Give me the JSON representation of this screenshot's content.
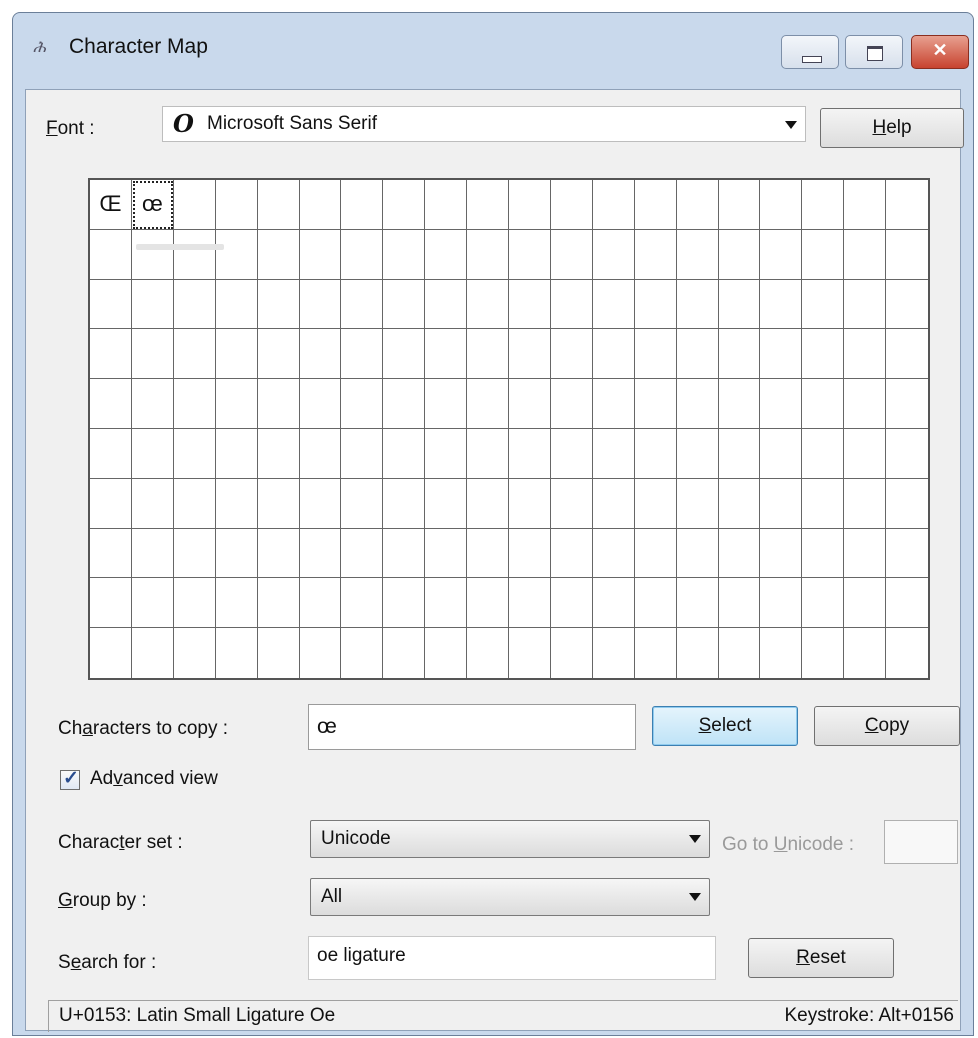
{
  "window": {
    "title": "Character Map",
    "controls": {
      "minimize": "–",
      "maximize": "□",
      "close": "✕"
    }
  },
  "font": {
    "label_prefix": "",
    "label_accel": "F",
    "label_rest": "ont :",
    "value": "Microsoft Sans Serif",
    "font_icon": "O"
  },
  "help_button": {
    "accel": "H",
    "rest": "elp"
  },
  "grid": {
    "columns": 20,
    "rows": 10,
    "characters": [
      "Œ",
      "œ"
    ],
    "selected_index": 1
  },
  "copy": {
    "label_pre": "Ch",
    "label_accel": "a",
    "label_post": "racters to copy :",
    "value": "œ",
    "select_accel": "S",
    "select_rest": "elect",
    "copy_accel": "C",
    "copy_rest": "opy"
  },
  "advanced_view": {
    "label_pre": "Ad",
    "label_accel": "v",
    "label_post": "anced view",
    "checked": true
  },
  "character_set": {
    "label_pre": "Charac",
    "label_accel": "t",
    "label_post": "er set :",
    "value": "Unicode"
  },
  "go_to_unicode": {
    "label_pre": "Go to ",
    "label_accel": "U",
    "label_post": "nicode :"
  },
  "group_by": {
    "label_accel": "G",
    "label_post": "roup by :",
    "value": "All"
  },
  "search": {
    "label_pre": "S",
    "label_accel": "e",
    "label_post": "arch for :",
    "value": "oe ligature",
    "reset_accel": "R",
    "reset_rest": "eset"
  },
  "status": {
    "left": "U+0153: Latin Small Ligature Oe",
    "right": "Keystroke: Alt+0156"
  },
  "colors": {
    "window_frame": "#c9d9ec",
    "client_bg": "#f0f0f0",
    "close_button": "#c8432f",
    "focus_button": "#bfe3f7"
  }
}
